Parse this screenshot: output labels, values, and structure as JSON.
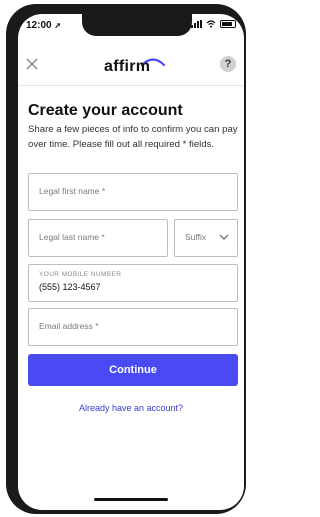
{
  "status_bar": {
    "time": "12:00"
  },
  "header": {
    "brand": "affirm",
    "help_label": "?"
  },
  "page": {
    "title": "Create your account",
    "description": "Share a few pieces of info to confirm you can pay over time. Please fill out all required * fields."
  },
  "form": {
    "first_name_placeholder": "Legal first name *",
    "last_name_placeholder": "Legal last name *",
    "suffix_placeholder": "Suffix",
    "mobile_label": "YOUR MOBILE NUMBER",
    "mobile_value": "(555) 123-4567",
    "email_placeholder": "Email address *"
  },
  "actions": {
    "continue_label": "Continue",
    "signin_link": "Already have an account?"
  },
  "icons": {
    "close": "close-icon",
    "help": "help-icon",
    "chevron": "chevron-down-icon",
    "location": "location-arrow-icon"
  },
  "colors": {
    "accent": "#4a4af4",
    "link": "#3b3bd6"
  }
}
